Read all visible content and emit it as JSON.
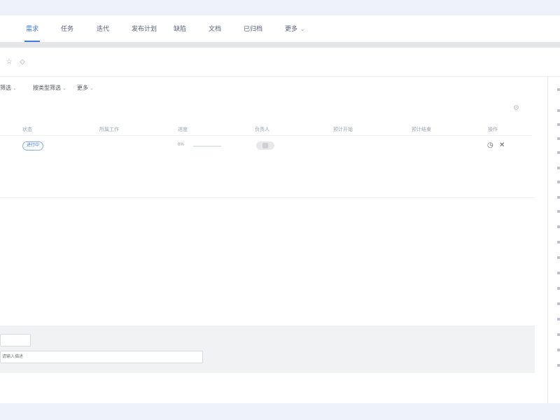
{
  "nav": {
    "tabs": [
      {
        "label": "需求",
        "active": true
      },
      {
        "label": "任务",
        "active": false
      },
      {
        "label": "迭代",
        "active": false
      },
      {
        "label": "发布计划",
        "active": false
      },
      {
        "label": "缺陷",
        "active": false
      },
      {
        "label": "文档",
        "active": false
      },
      {
        "label": "已归档",
        "active": false
      },
      {
        "label": "更多",
        "active": false
      }
    ]
  },
  "toolbar": {
    "icons": [
      "star-icon",
      "link-icon"
    ]
  },
  "filters": [
    {
      "label": "筛选"
    },
    {
      "label": "按类型筛选"
    },
    {
      "label": "更多"
    }
  ],
  "table": {
    "columns": [
      "状态",
      "所属工作",
      "进度",
      "负责人",
      "预计开始",
      "预计结束",
      "操作"
    ],
    "rows": [
      {
        "status": "进行中",
        "progress_text": "0%",
        "progress": 0
      }
    ]
  },
  "bottom": {
    "wide_placeholder": "请输入描述"
  },
  "colors": {
    "accent": "#3f7be0",
    "page_bg": "#eef3fb",
    "panel_bg": "#f1f2f4"
  }
}
